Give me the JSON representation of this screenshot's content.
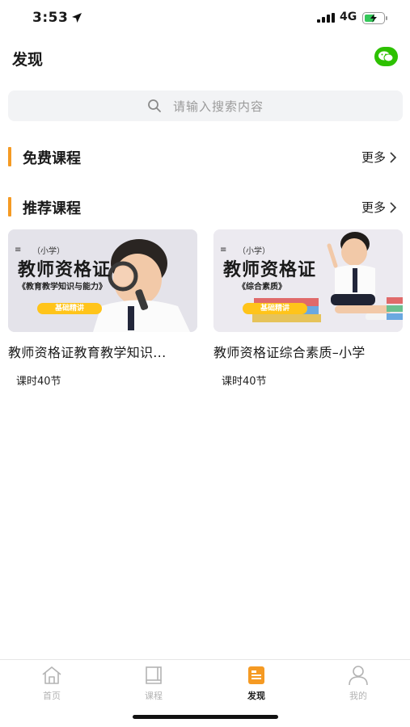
{
  "status_bar": {
    "time": "3:53",
    "network": "4G"
  },
  "header": {
    "title": "发现",
    "share_icon": "wechat-icon",
    "share_color": "#2dc100"
  },
  "search": {
    "placeholder": "请输入搜索内容"
  },
  "sections": {
    "free": {
      "title": "免费课程",
      "more": "更多"
    },
    "recommended": {
      "title": "推荐课程",
      "more": "更多"
    }
  },
  "courses": [
    {
      "title": "教师资格证教育教学知识...",
      "hours": "课时40节",
      "thumb": {
        "menu": "≡",
        "level": "（小学）",
        "heading": "教师资格证",
        "subtitle": "《教育教学知识与能力》",
        "tag": "基础精讲"
      }
    },
    {
      "title": "教师资格证综合素质–小学",
      "hours": "课时40节",
      "thumb": {
        "menu": "≡",
        "level": "（小学）",
        "heading": "教师资格证",
        "subtitle": "《综合素质》",
        "tag": "基础精讲"
      }
    }
  ],
  "tabs": [
    {
      "label": "首页",
      "icon": "home-icon",
      "active": false
    },
    {
      "label": "课程",
      "icon": "book-icon",
      "active": false
    },
    {
      "label": "发现",
      "icon": "discover-icon",
      "active": true
    },
    {
      "label": "我的",
      "icon": "user-icon",
      "active": false
    }
  ],
  "colors": {
    "accent": "#f59a23",
    "tag": "#ffc41a",
    "inactive": "#b3b3b3"
  }
}
